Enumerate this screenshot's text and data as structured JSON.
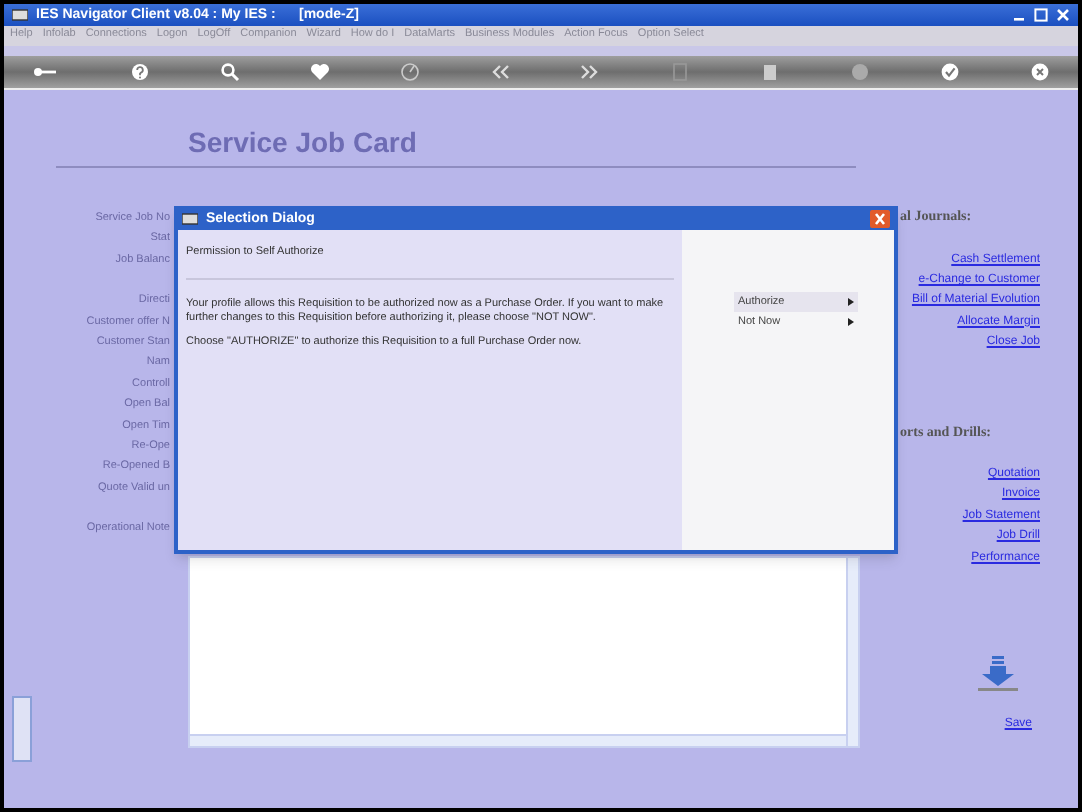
{
  "window": {
    "title": "IES Navigator Client v8.04 : My IES :      [mode-Z]"
  },
  "menu": [
    "Help",
    "Infolab",
    "Connections",
    "Logon",
    "LogOff",
    "Companion",
    "Wizard",
    "How do I",
    "DataMarts",
    "Business Modules",
    "Action Focus",
    "Option Select"
  ],
  "form": {
    "title": "Service Job Card",
    "labels": [
      "Service Job No",
      "Stat",
      "Job Balanc",
      "Directi",
      "Customer offer N",
      "Customer Stan",
      "Nam",
      "Controll",
      "Open Bal",
      "Open Tim",
      "Re-Ope",
      "Re-Opened B",
      "Quote Valid un",
      "Operational Note"
    ]
  },
  "side_panel": {
    "sections": [
      {
        "heading": "al Journals:",
        "links": [
          "Cash Settlement",
          "e-Change to Customer",
          "Bill of Material Evolution",
          "Allocate Margin",
          "Close Job"
        ]
      },
      {
        "heading": "orts and Drills:",
        "links": [
          "Quotation",
          "Invoice",
          "Job Statement",
          "Job Drill",
          "Performance"
        ]
      }
    ],
    "save": "Save"
  },
  "dialog": {
    "title": "Selection Dialog",
    "heading": "Permission to Self Authorize",
    "paragraphs": [
      "Your profile allows this Requisition to be authorized now as a Purchase Order. If you want to make further changes to this Requisition before authorizing it, please choose \"NOT NOW\".",
      "Choose \"AUTHORIZE\" to authorize this Requisition to a full Purchase Order now."
    ],
    "options": [
      {
        "label": "Authorize",
        "selected": true
      },
      {
        "label": "Not Now",
        "selected": false
      }
    ]
  }
}
